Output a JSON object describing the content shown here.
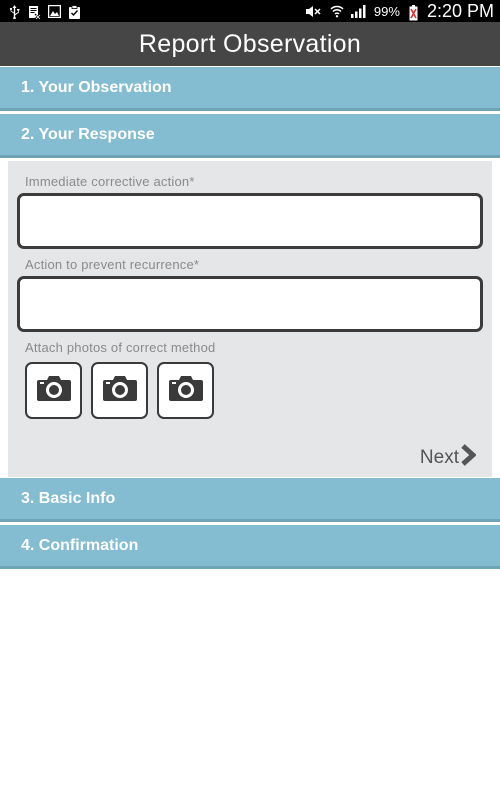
{
  "status_bar": {
    "battery_percent": "99%",
    "time": "2:20 PM",
    "icons": [
      "usb-icon",
      "document-icon",
      "image-icon",
      "clipboard-icon",
      "mute-icon",
      "wifi-icon",
      "signal-icon",
      "battery-icon"
    ]
  },
  "header": {
    "title": "Report Observation"
  },
  "sections": [
    {
      "label": "1. Your Observation"
    },
    {
      "label": "2. Your Response"
    },
    {
      "label": "3. Basic Info"
    },
    {
      "label": "4. Confirmation"
    }
  ],
  "response_form": {
    "immediate_action_label": "Immediate corrective action*",
    "immediate_action_value": "",
    "prevent_recurrence_label": "Action to prevent recurrence*",
    "prevent_recurrence_value": "",
    "photos_label": "Attach photos of correct method",
    "photo_buttons": [
      "camera-icon",
      "camera-icon",
      "camera-icon"
    ],
    "next_label": "Next"
  },
  "colors": {
    "status_bar": "#000000",
    "title_bar": "#464646",
    "section_header": "#84bdd1",
    "panel_background": "#e5e6e7"
  }
}
